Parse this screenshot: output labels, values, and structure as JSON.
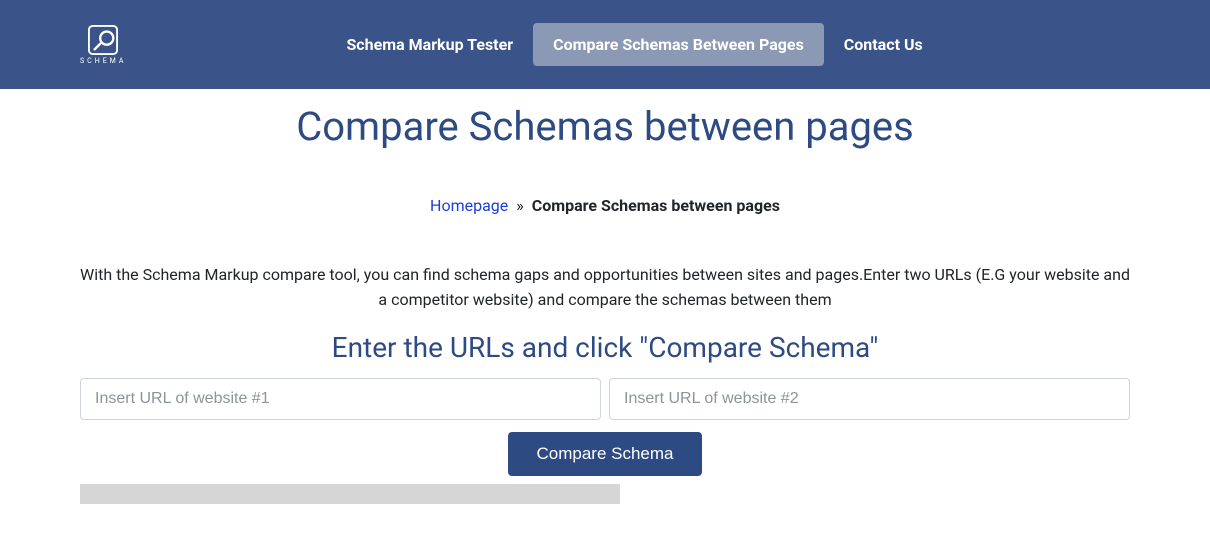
{
  "brand": {
    "logo_text": "SCHEMA"
  },
  "nav": {
    "items": [
      {
        "label": "Schema Markup Tester",
        "active": false
      },
      {
        "label": "Compare Schemas Between Pages",
        "active": true
      },
      {
        "label": "Contact Us",
        "active": false
      }
    ]
  },
  "page": {
    "title": "Compare Schemas between pages"
  },
  "breadcrumb": {
    "home_label": "Homepage",
    "separator": "»",
    "current": "Compare Schemas between pages"
  },
  "description": "With the Schema Markup compare tool, you can find schema gaps and opportunities between sites and pages.Enter two URLs (E.G your website and a competitor website) and compare the schemas between them",
  "form": {
    "heading": "Enter the URLs and click \"Compare Schema\"",
    "url1_placeholder": "Insert URL of website #1",
    "url2_placeholder": "Insert URL of website #2",
    "url1_value": "",
    "url2_value": "",
    "button_label": "Compare Schema"
  }
}
